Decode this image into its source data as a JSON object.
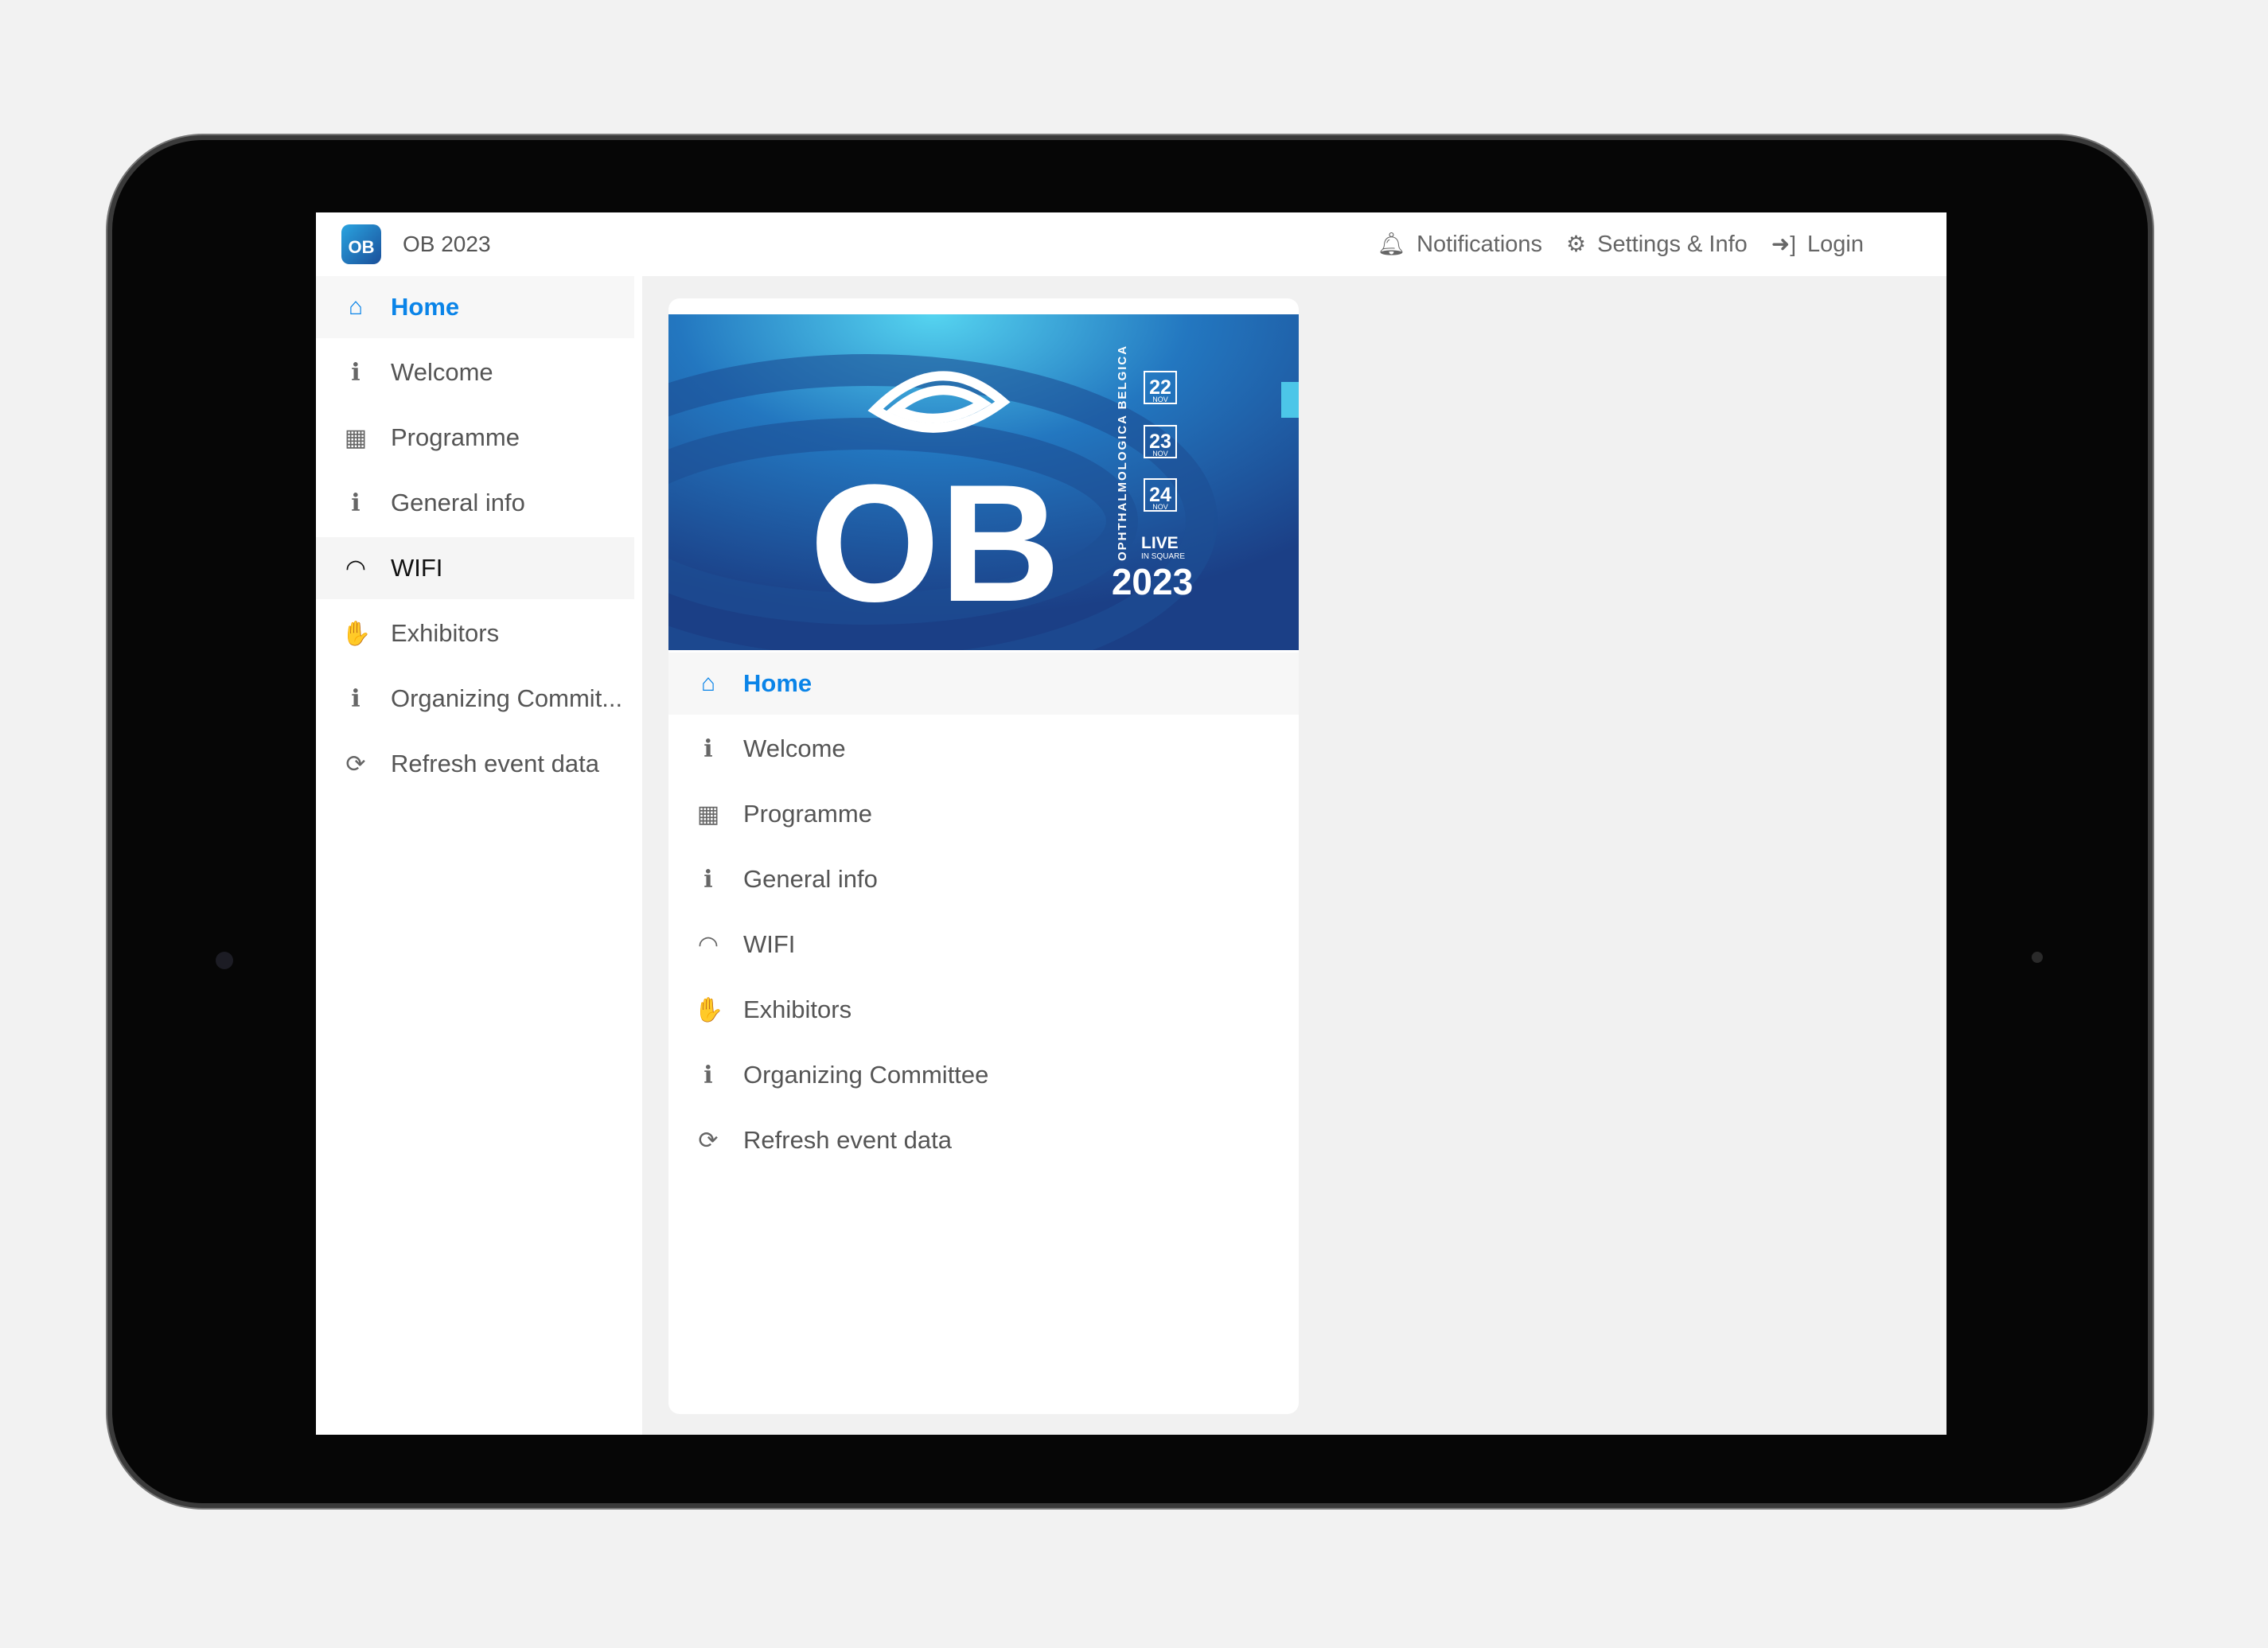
{
  "header": {
    "app_title": "OB 2023",
    "logo_text": "OB",
    "nav": [
      {
        "icon": "bell-icon",
        "label": "Notifications"
      },
      {
        "icon": "gear-icon",
        "label": "Settings & Info"
      },
      {
        "icon": "login-icon",
        "label": "Login"
      }
    ]
  },
  "menu": [
    {
      "icon": "home-icon",
      "glyph": "⌂",
      "label": "Home",
      "active": true
    },
    {
      "icon": "info-icon",
      "glyph": "i",
      "label": "Welcome"
    },
    {
      "icon": "calendar-icon",
      "glyph": "▦",
      "label": "Programme"
    },
    {
      "icon": "info-icon",
      "glyph": "i",
      "label": "General info"
    },
    {
      "icon": "wifi-icon",
      "glyph": "◠",
      "label": "WIFI"
    },
    {
      "icon": "handshake-icon",
      "glyph": "✋",
      "label": "Exhibitors"
    },
    {
      "icon": "info-icon",
      "glyph": "i",
      "label": "Organizing Committee"
    },
    {
      "icon": "refresh-icon",
      "glyph": "⟳",
      "label": "Refresh event data"
    }
  ],
  "sidebar_truncated_label": "Organizing Commit...",
  "banner": {
    "big": "OB",
    "year": "2023",
    "vertical": "OPHTHALMOLOGICA BELGICA",
    "dates": [
      {
        "d": "22",
        "m": "NOV"
      },
      {
        "d": "23",
        "m": "NOV"
      },
      {
        "d": "24",
        "m": "NOV"
      }
    ],
    "live": "LIVE",
    "live_sub": "IN SQUARE"
  },
  "colors": {
    "accent": "#0a84e8",
    "banner_dark": "#1b3f86",
    "banner_light": "#55d4f0"
  }
}
